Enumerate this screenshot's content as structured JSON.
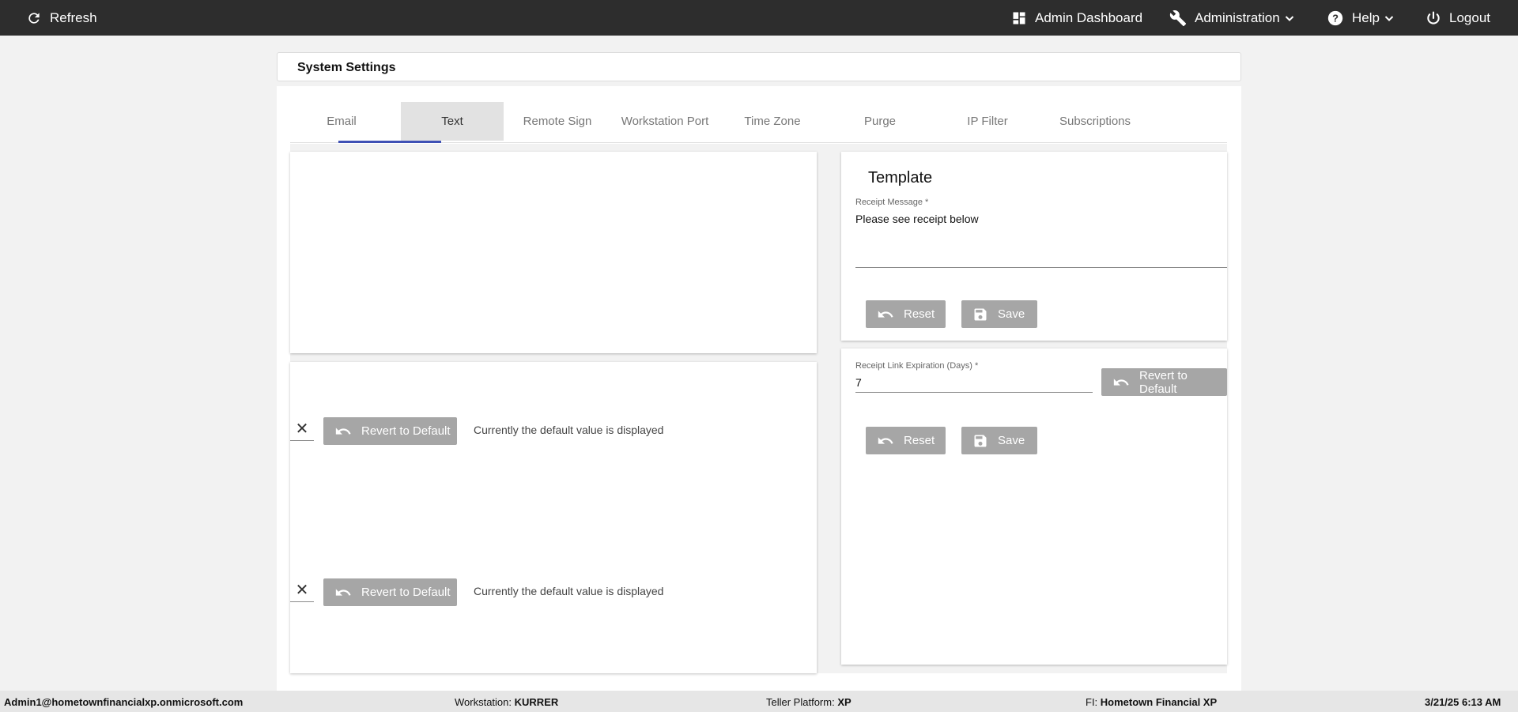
{
  "topbar": {
    "refresh_label": "Refresh",
    "admin_dashboard_label": "Admin Dashboard",
    "administration_label": "Administration",
    "help_label": "Help",
    "logout_label": "Logout",
    "icons": [
      "refresh-icon",
      "dashboard-icon",
      "wrench-icon",
      "chevron-down-icon",
      "help-circle-icon",
      "power-icon"
    ]
  },
  "header": {
    "title": "System Settings"
  },
  "tabs": [
    {
      "label": "Email"
    },
    {
      "label": "Text",
      "active": true
    },
    {
      "label": "Remote Sign"
    },
    {
      "label": "Workstation Port"
    },
    {
      "label": "Time Zone"
    },
    {
      "label": "Purge"
    },
    {
      "label": "IP Filter"
    },
    {
      "label": "Subscriptions"
    }
  ],
  "left_panel": {
    "rows": [
      {
        "clear_glyph": "✕",
        "revert_label": "Revert to Default",
        "status": "Currently the default value is displayed"
      },
      {
        "clear_glyph": "✕",
        "revert_label": "Revert to Default",
        "status": "Currently the default value is displayed"
      }
    ]
  },
  "template": {
    "title": "Template",
    "receipt_message_label": "Receipt Message *",
    "receipt_message_value": "Please see receipt below",
    "reset_label": "Reset",
    "save_label": "Save"
  },
  "expiration": {
    "label": "Receipt Link Expiration (Days) *",
    "value": "7",
    "revert_label": "Revert to Default",
    "reset_label": "Reset",
    "save_label": "Save"
  },
  "footer": {
    "user": "Admin1@hometownfinancialxp.onmicrosoft.com",
    "workstation_label": "Workstation:",
    "workstation_value": "KURRER",
    "platform_label": "Teller Platform:",
    "platform_value": "XP",
    "fi_label": "FI:",
    "fi_value": "Hometown Financial XP",
    "datetime": "3/21/25 6:13 AM"
  },
  "colors": {
    "topbar": "#2d2d2d",
    "tab_indicator": "#3f51b5",
    "button": "#a6a6a6",
    "background": "#f2f2f2"
  }
}
